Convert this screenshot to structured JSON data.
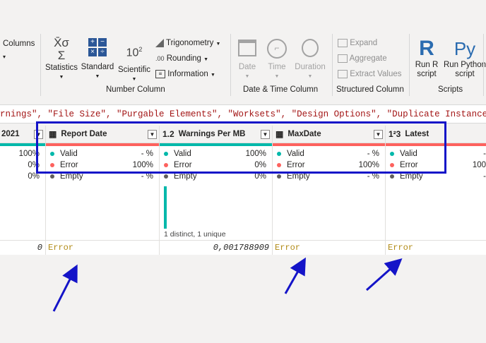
{
  "ribbon": {
    "columns_label": "Columns",
    "statistics": "Statistics",
    "standard": "Standard",
    "scientific": "Scientific",
    "trigonometry": "Trigonometry",
    "rounding": "Rounding",
    "information": "Information",
    "number_column_label": "Number Column",
    "date": "Date",
    "time": "Time",
    "duration": "Duration",
    "datetime_label": "Date & Time Column",
    "expand": "Expand",
    "aggregate": "Aggregate",
    "extract_values": "Extract Values",
    "structured_label": "Structured Column",
    "run_r_line1": "Run R",
    "run_r_line2": "script",
    "run_python_line1": "Run Python",
    "run_python_line2": "script",
    "scripts_label": "Scripts"
  },
  "formula_text": "rnings\", \"File Size\", \"Purgable Elements\", \"Worksets\", \"Design Options\", \"Duplicate Instances\", \"Linked F",
  "columns": [
    {
      "name": "2021",
      "type_icon": "",
      "valid": "100%",
      "error": "0%",
      "empty": "0%",
      "cell": "0"
    },
    {
      "name": "Report Date",
      "type_icon": "calendar-icon",
      "valid_label": "Valid",
      "valid": "- %",
      "error_label": "Error",
      "error": "100%",
      "empty_label": "Empty",
      "empty": "- %",
      "cell": "Error"
    },
    {
      "name": "Warnings Per MB",
      "type_icon_text": "1.2",
      "valid_label": "Valid",
      "valid": "100%",
      "error_label": "Error",
      "error": "0%",
      "empty_label": "Empty",
      "empty": "0%",
      "distinct": "1 distinct, 1 unique",
      "cell": "0,001788909"
    },
    {
      "name": "MaxDate",
      "type_icon": "calendar-icon",
      "valid_label": "Valid",
      "valid": "- %",
      "error_label": "Error",
      "error": "100%",
      "empty_label": "Empty",
      "empty": "- %",
      "cell": "Error"
    },
    {
      "name": "Latest",
      "type_icon_text": "1²3",
      "valid_label": "Valid",
      "valid": "-",
      "error_label": "Error",
      "error": "100",
      "empty_label": "Empty",
      "empty": "-",
      "cell": "Error"
    }
  ],
  "colors": {
    "valid": "#01b8aa",
    "error": "#fd625e",
    "empty": "#605e5c",
    "annotation": "#1414c8",
    "error_text": "#b28b17"
  }
}
